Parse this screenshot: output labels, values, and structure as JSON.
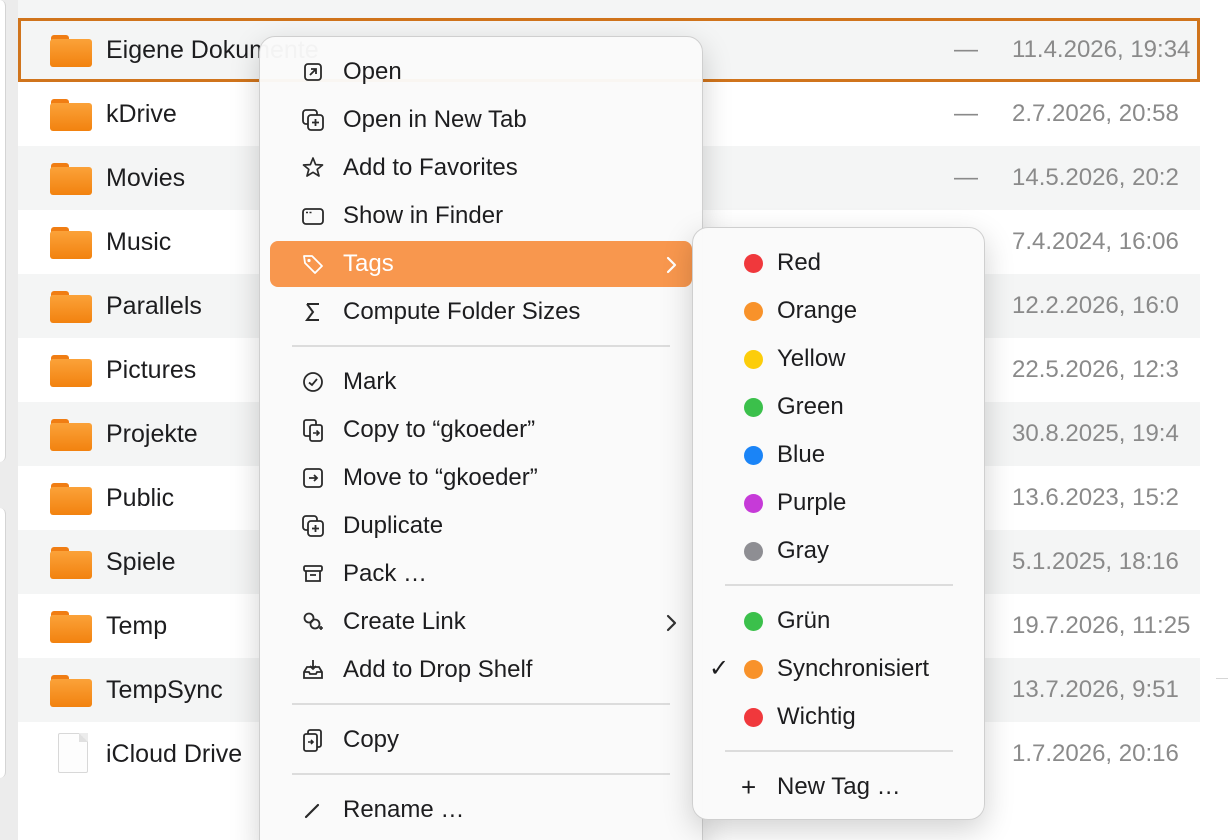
{
  "files": [
    {
      "name": "Eigene Dokumente",
      "size": "—",
      "date": "11.4.2026, 19:34",
      "kind": "folder"
    },
    {
      "name": "kDrive",
      "size": "—",
      "date": "2.7.2026, 20:58",
      "kind": "folder"
    },
    {
      "name": "Movies",
      "size": "—",
      "date": "14.5.2026, 20:2",
      "kind": "folder"
    },
    {
      "name": "Music",
      "size": "",
      "date": "7.4.2024, 16:06",
      "kind": "folder"
    },
    {
      "name": "Parallels",
      "size": "",
      "date": "12.2.2026, 16:0",
      "kind": "folder"
    },
    {
      "name": "Pictures",
      "size": "",
      "date": "22.5.2026, 12:3",
      "kind": "folder"
    },
    {
      "name": "Projekte",
      "size": "",
      "date": "30.8.2025, 19:4",
      "kind": "folder"
    },
    {
      "name": "Public",
      "size": "",
      "date": "13.6.2023, 15:2",
      "kind": "folder"
    },
    {
      "name": "Spiele",
      "size": "",
      "date": "5.1.2025, 18:16",
      "kind": "folder"
    },
    {
      "name": "Temp",
      "size": "",
      "date": "19.7.2026, 11:25",
      "kind": "folder"
    },
    {
      "name": "TempSync",
      "size": "",
      "date": "13.7.2026, 9:51",
      "kind": "folder"
    },
    {
      "name": "iCloud Drive",
      "size": "",
      "date": "1.7.2026, 20:16",
      "kind": "file"
    }
  ],
  "context_menu": {
    "items": [
      {
        "label": "Open",
        "icon": "open-icon"
      },
      {
        "label": "Open in New Tab",
        "icon": "new-tab-icon"
      },
      {
        "label": "Add to Favorites",
        "icon": "star-icon"
      },
      {
        "label": "Show in Finder",
        "icon": "window-icon"
      },
      {
        "label": "Tags",
        "icon": "tag-icon",
        "submenu": true,
        "highlighted": true
      },
      {
        "label": "Compute Folder Sizes",
        "icon": "sigma-icon"
      },
      {
        "label": "Mark",
        "icon": "checkmark-circle-icon"
      },
      {
        "label": "Copy to “gkoeder”",
        "icon": "copy-to-icon"
      },
      {
        "label": "Move to “gkoeder”",
        "icon": "move-to-icon"
      },
      {
        "label": "Duplicate",
        "icon": "duplicate-icon"
      },
      {
        "label": "Pack …",
        "icon": "archive-icon"
      },
      {
        "label": "Create Link",
        "icon": "link-icon",
        "submenu": true
      },
      {
        "label": "Add to Drop Shelf",
        "icon": "drop-shelf-icon"
      },
      {
        "label": "Copy",
        "icon": "copy-icon"
      },
      {
        "label": "Rename …",
        "icon": "pencil-icon"
      }
    ],
    "highlight_color": "#f8974e"
  },
  "tags_submenu": {
    "colors": [
      {
        "label": "Red",
        "color": "#f0383c"
      },
      {
        "label": "Orange",
        "color": "#f8922a"
      },
      {
        "label": "Yellow",
        "color": "#fccd0a"
      },
      {
        "label": "Green",
        "color": "#3bc04b"
      },
      {
        "label": "Blue",
        "color": "#1a84f7"
      },
      {
        "label": "Purple",
        "color": "#c63ad8"
      },
      {
        "label": "Gray",
        "color": "#8e8e93"
      }
    ],
    "custom": [
      {
        "label": "Grün",
        "color": "#3bc04b",
        "checked": false
      },
      {
        "label": "Synchronisiert",
        "color": "#f8922a",
        "checked": true
      },
      {
        "label": "Wichtig",
        "color": "#f0383c",
        "checked": false
      }
    ],
    "new_tag_label": "New Tag …",
    "check_glyph": "✓",
    "plus_glyph": "+"
  },
  "colors": {
    "selection_outline": "#d0741c",
    "folder": "#f8922a"
  }
}
